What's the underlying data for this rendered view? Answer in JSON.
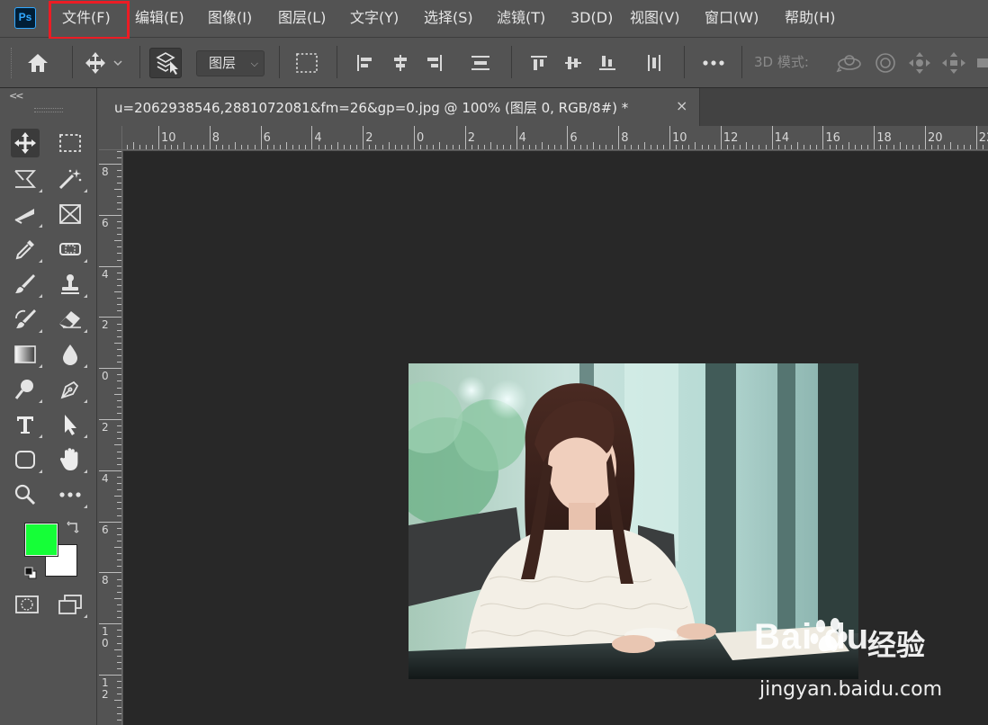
{
  "app": {
    "logo": "Ps"
  },
  "menu": {
    "items": [
      "文件(F)",
      "编辑(E)",
      "图像(I)",
      "图层(L)",
      "文字(Y)",
      "选择(S)",
      "滤镜(T)",
      "3D(D)",
      "视图(V)",
      "窗口(W)",
      "帮助(H)"
    ],
    "highlighted": "文件(F)",
    "highlight_color": "#ec1c24"
  },
  "options_bar": {
    "layer_select_value": "图层",
    "mode_3d_label": "3D 模式:"
  },
  "toolbar": {
    "collapse_label": "<<",
    "foreground_color": "#15ff37",
    "background_color": "#ffffff"
  },
  "document": {
    "tab_title": "u=2062938546,2881072081&fm=26&gp=0.jpg @ 100% (图层 0, RGB/8#) *",
    "close_glyph": "×"
  },
  "rulers": {
    "horizontal_labels": [
      "10",
      "8",
      "6",
      "4",
      "2",
      "0",
      "2",
      "4",
      "6",
      "8",
      "10",
      "12",
      "14",
      "16",
      "18",
      "20",
      "22"
    ],
    "vertical_labels": [
      "8",
      "6",
      "4",
      "2",
      "0",
      "2",
      "4",
      "6",
      "8",
      "1\n0",
      "1\n2"
    ]
  },
  "watermark": {
    "brand": "Bai  du",
    "product": "经验",
    "url": "jingyan.baidu.com"
  }
}
